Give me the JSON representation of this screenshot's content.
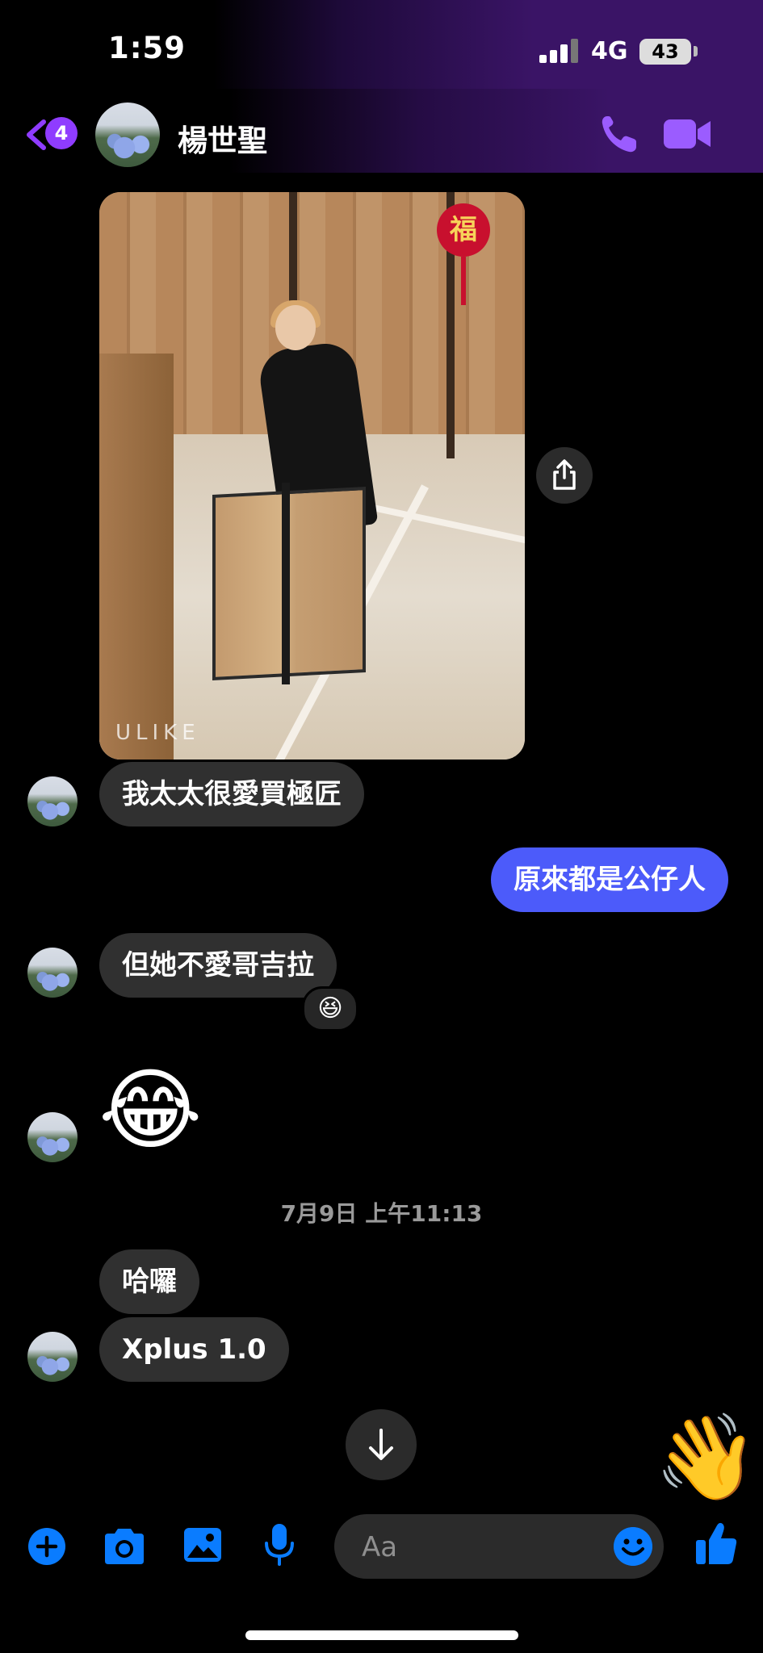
{
  "status": {
    "time": "1:59",
    "network": "4G",
    "battery": "43"
  },
  "header": {
    "unread_count": "4",
    "contact_name": "楊世聖"
  },
  "photo": {
    "sign_char": "福",
    "watermark": "ULIKE"
  },
  "messages": [
    {
      "text": "我太太很愛買極匠"
    },
    {
      "text": "原來都是公仔人"
    },
    {
      "text": "但她不愛哥吉拉",
      "reaction": "😆"
    },
    {
      "text": "😂"
    },
    {
      "text": "哈囉"
    },
    {
      "text": "Xplus 1.0"
    }
  ],
  "date_divider": "7月9日 上午11:13",
  "composer": {
    "placeholder": "Aa",
    "wave": "👋"
  },
  "colors": {
    "accent_purple": "#8f3cff",
    "outgoing_bubble": "#4c5bfa",
    "incoming_bubble": "#303030",
    "toolbar_blue": "#0a7cff"
  }
}
